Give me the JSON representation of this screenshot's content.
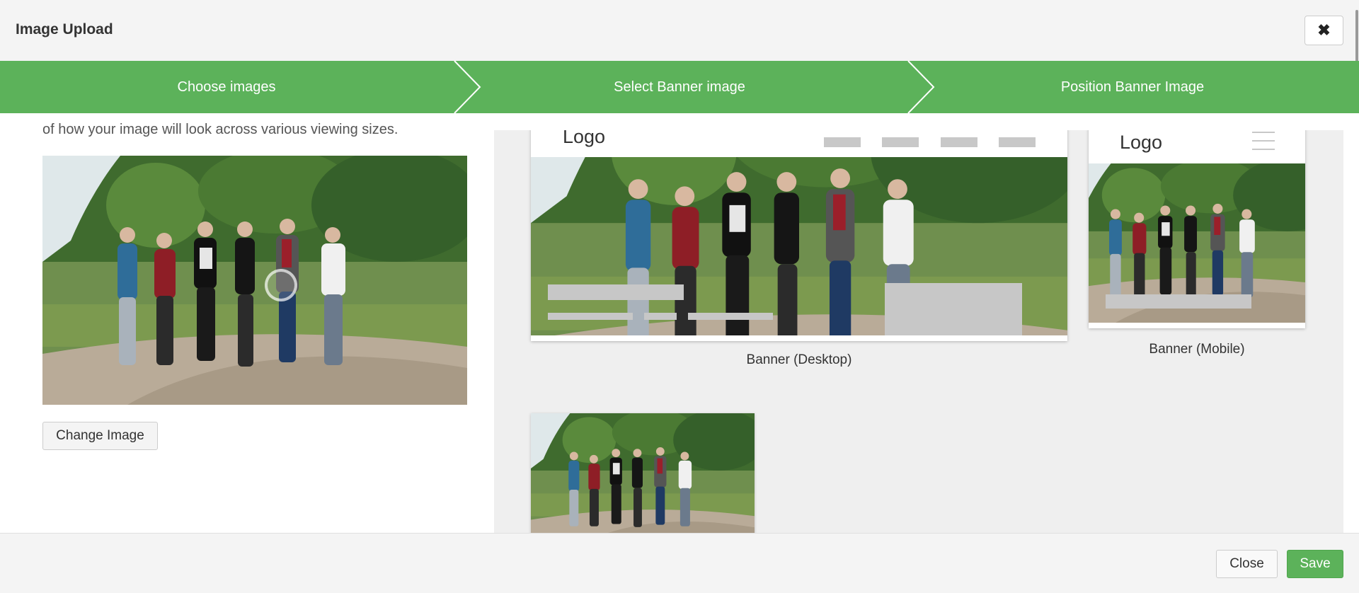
{
  "dialog": {
    "title": "Image Upload",
    "close_icon": "close-icon"
  },
  "steps": [
    {
      "label": "Choose images"
    },
    {
      "label": "Select Banner image"
    },
    {
      "label": "Position Banner Image"
    }
  ],
  "left": {
    "partial_text": "of how your image will look across various viewing sizes.",
    "change_button": "Change Image"
  },
  "previews": {
    "desktop": {
      "logo": "Logo",
      "caption": "Banner (Desktop)"
    },
    "mobile": {
      "logo": "Logo",
      "caption": "Banner (Mobile)"
    }
  },
  "footer": {
    "close": "Close",
    "save": "Save"
  },
  "colors": {
    "accent": "#5cb25a",
    "placeholder": "#c7c7c7"
  }
}
